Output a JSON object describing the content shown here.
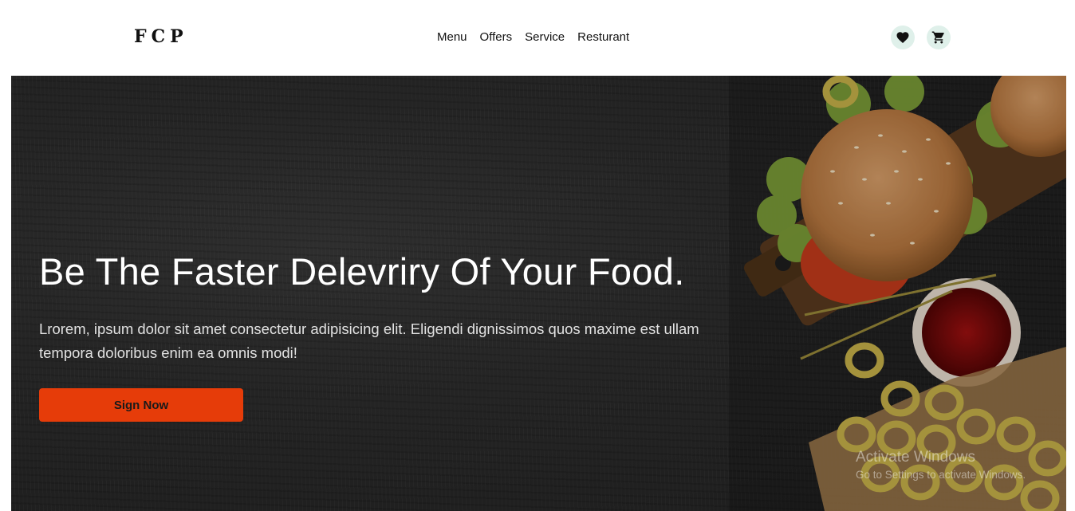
{
  "header": {
    "logo": "FCP",
    "nav": [
      "Menu",
      "Offers",
      "Service",
      "Resturant"
    ],
    "icons": [
      "heart-icon",
      "cart-icon"
    ],
    "icon_bg": "#dff0ea"
  },
  "hero": {
    "title": "Be The Faster Delevriry Of Your Food.",
    "text": "Lrorem, ipsum dolor sit amet consectetur adipisicing elit. Eligendi dignissimos quos maxime est ullam tempora doloribus enim ea omnis modi!",
    "button_label": "Sign Now",
    "accent_color": "#e63c09",
    "background_color": "#242424"
  },
  "watermark": {
    "title": "Activate Windows",
    "subtitle": "Go to Settings to activate Windows."
  }
}
